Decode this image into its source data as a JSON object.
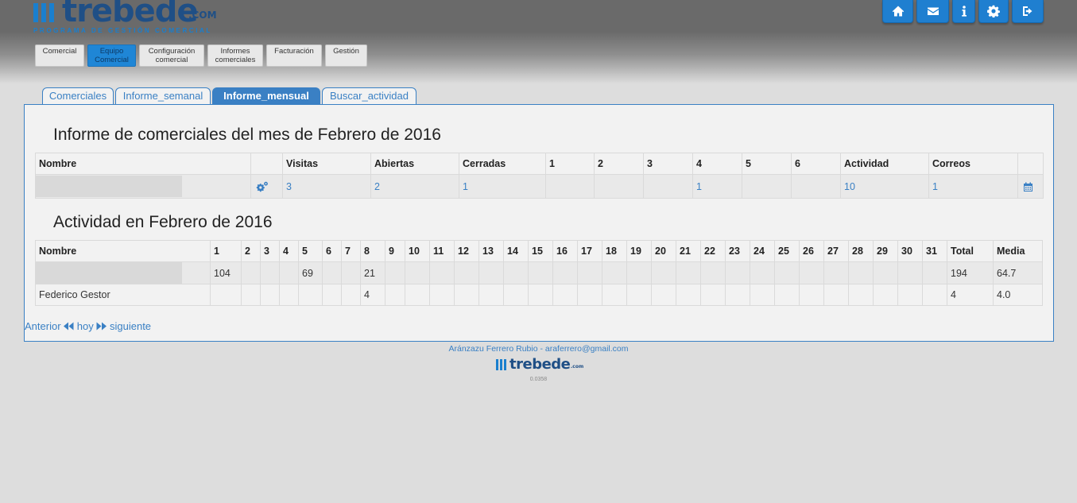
{
  "brand": {
    "word": "trebede",
    "suffix": ".COM",
    "tagline": "PROGRAMA DE GESTIÓN COMERCIAL"
  },
  "toolbar_icons": [
    "home-icon",
    "envelope-icon",
    "info-icon",
    "gear-icon",
    "sign-out-icon"
  ],
  "menu": [
    {
      "line1": "Comercial",
      "line2": "",
      "active": false
    },
    {
      "line1": "Equipo",
      "line2": "Comercial",
      "active": true
    },
    {
      "line1": "Configuración",
      "line2": "comercial",
      "active": false
    },
    {
      "line1": "Informes",
      "line2": "comerciales",
      "active": false
    },
    {
      "line1": "Facturación",
      "line2": "",
      "active": false
    },
    {
      "line1": "Gestión",
      "line2": "",
      "active": false
    }
  ],
  "tabs": [
    {
      "label": "Comerciales",
      "active": false
    },
    {
      "label": "Informe_semanal",
      "active": false
    },
    {
      "label": "Informe_mensual",
      "active": true
    },
    {
      "label": "Buscar_actividad",
      "active": false
    }
  ],
  "report": {
    "title": "Informe de comerciales del mes de Febrero de 2016",
    "headers": [
      "Nombre",
      "",
      "Visitas",
      "Abiertas",
      "Cerradas",
      "1",
      "2",
      "3",
      "4",
      "5",
      "6",
      "Actividad",
      "Correos",
      ""
    ],
    "row": {
      "nombre": "",
      "visitas": "3",
      "abiertas": "2",
      "cerradas": "1",
      "c1": "",
      "c2": "",
      "c3": "",
      "c4": "1",
      "c5": "",
      "c6": "",
      "actividad": "10",
      "correos": "1"
    }
  },
  "activity": {
    "title": "Actividad en Febrero de 2016",
    "headers": [
      "Nombre",
      "1",
      "2",
      "3",
      "4",
      "5",
      "6",
      "7",
      "8",
      "9",
      "10",
      "11",
      "12",
      "13",
      "14",
      "15",
      "16",
      "17",
      "18",
      "19",
      "20",
      "21",
      "22",
      "23",
      "24",
      "25",
      "26",
      "27",
      "28",
      "29",
      "30",
      "31",
      "Total",
      "Media"
    ],
    "rows": [
      {
        "name": "",
        "days": [
          "104",
          "",
          "",
          "",
          "69",
          "",
          "",
          "21",
          "",
          "",
          "",
          "",
          "",
          "",
          "",
          "",
          "",
          "",
          "",
          "",
          "",
          "",
          "",
          "",
          "",
          "",
          "",
          "",
          "",
          "",
          ""
        ],
        "total": "194",
        "media": "64.7"
      },
      {
        "name": "Federico Gestor",
        "days": [
          "",
          "",
          "",
          "",
          "",
          "",
          "",
          "4",
          "",
          "",
          "",
          "",
          "",
          "",
          "",
          "",
          "",
          "",
          "",
          "",
          "",
          "",
          "",
          "",
          "",
          "",
          "",
          "",
          "",
          "",
          ""
        ],
        "total": "4",
        "media": "4.0"
      }
    ]
  },
  "pager": {
    "prev": "Anterior",
    "today": "hoy",
    "next": "siguiente"
  },
  "footer": {
    "author": "Aránzazu Ferrero Rubio - araferrero@gmail.com",
    "logo_word": "trebede",
    "logo_suffix": ".com",
    "version": "0.0358"
  }
}
